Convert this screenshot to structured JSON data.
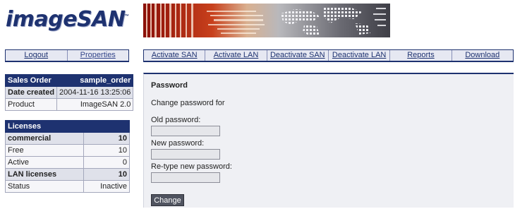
{
  "brand": {
    "name": "imageSAN",
    "tm": "™"
  },
  "nav_left": [
    "Logout",
    "Properties"
  ],
  "nav_right": [
    "Activate SAN",
    "Activate LAN",
    "Deactivate SAN",
    "Deactivate LAN",
    "Reports",
    "Download"
  ],
  "order": {
    "header": {
      "label": "Sales Order",
      "value": "sample_order"
    },
    "rows": [
      {
        "label": "Date created",
        "value": "2004-11-16 13:25:06"
      },
      {
        "label": "Product",
        "value": "ImageSAN 2.0"
      }
    ]
  },
  "licenses": {
    "header": "Licenses",
    "rows": [
      {
        "label": "commercial",
        "value": "10"
      },
      {
        "label": "Free",
        "value": "10"
      },
      {
        "label": "Active",
        "value": "0"
      },
      {
        "label": "LAN licenses",
        "value": "10"
      },
      {
        "label": "Status",
        "value": "Inactive"
      }
    ]
  },
  "password_form": {
    "title": "Password",
    "subtitle": "Change password for",
    "old_label": "Old password:",
    "old_value": "",
    "new_label": "New password:",
    "new_value": "",
    "retype_label": "Re-type new password:",
    "retype_value": "",
    "submit_label": "Change"
  },
  "colors": {
    "brand_navy": "#1e3270",
    "panel_bg": "#eff0f4",
    "button_bg": "#505460"
  }
}
